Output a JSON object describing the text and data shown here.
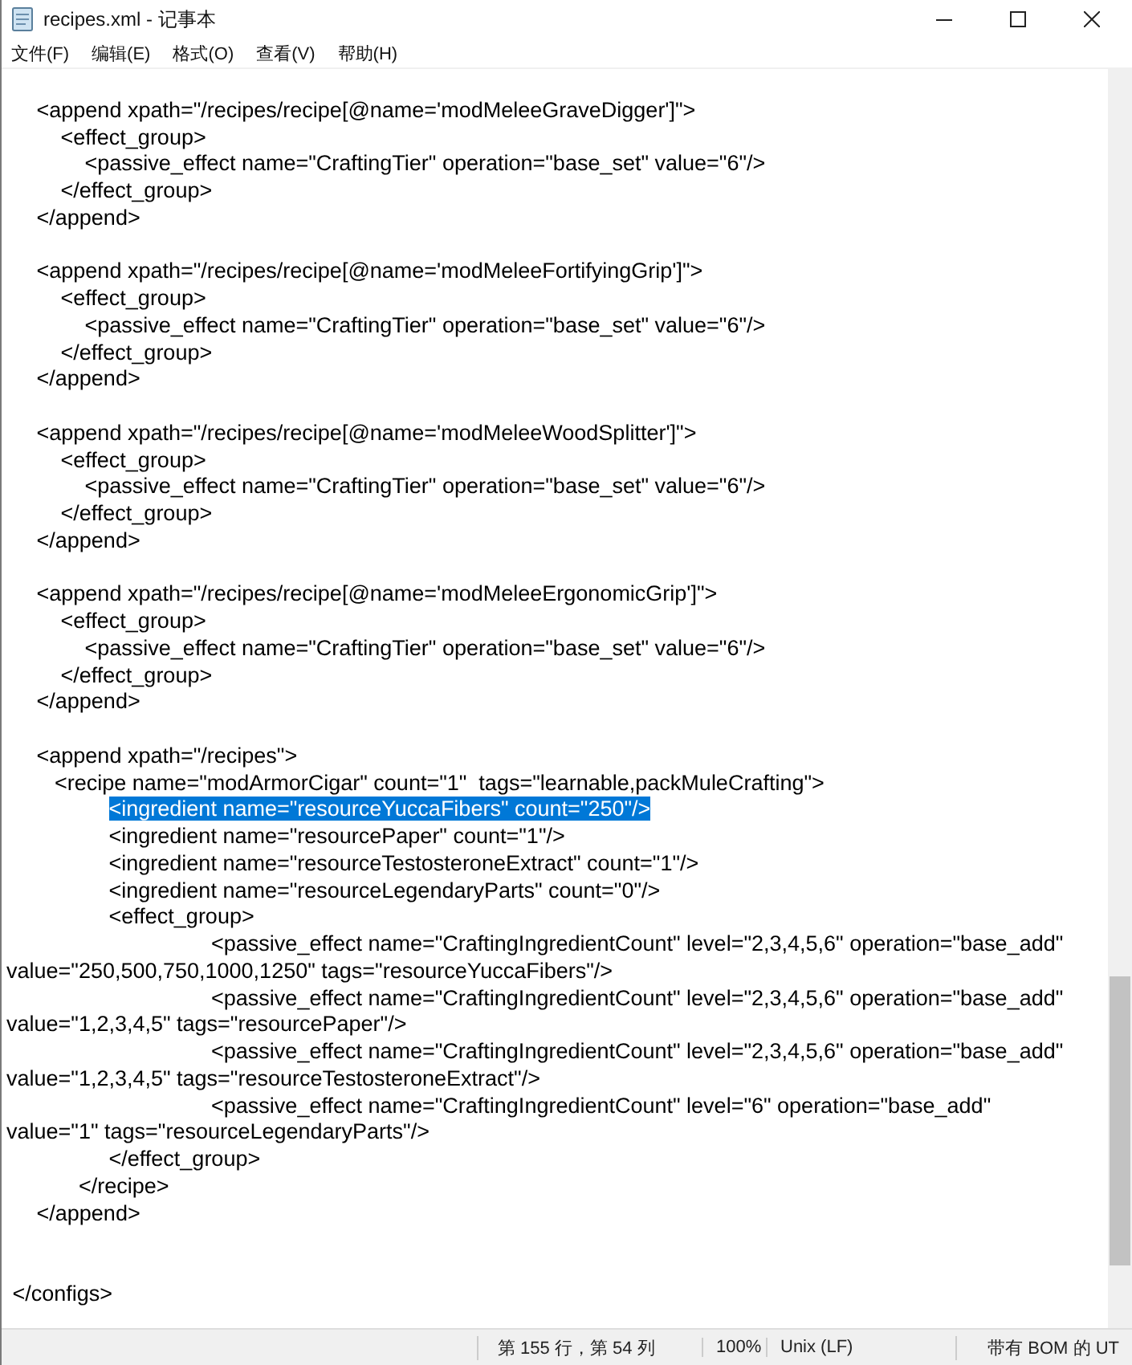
{
  "window": {
    "title": "recipes.xml - 记事本"
  },
  "menu": [
    "文件(F)",
    "编辑(E)",
    "格式(O)",
    "查看(V)",
    "帮助(H)"
  ],
  "lines": [
    {
      "kind": "blank",
      "selected": false
    },
    {
      "kind": "code",
      "text": "     <append xpath=\"/recipes/recipe[@name='modMeleeGraveDigger']\">",
      "selected": false
    },
    {
      "kind": "code",
      "text": "         <effect_group>",
      "selected": false
    },
    {
      "kind": "code",
      "text": "             <passive_effect name=\"CraftingTier\" operation=\"base_set\" value=\"6\"/>",
      "selected": false
    },
    {
      "kind": "code",
      "text": "         </effect_group>",
      "selected": false
    },
    {
      "kind": "code",
      "text": "     </append>",
      "selected": false
    },
    {
      "kind": "blank",
      "selected": false
    },
    {
      "kind": "code",
      "text": "     <append xpath=\"/recipes/recipe[@name='modMeleeFortifyingGrip']\">",
      "selected": false
    },
    {
      "kind": "code",
      "text": "         <effect_group>",
      "selected": false
    },
    {
      "kind": "code",
      "text": "             <passive_effect name=\"CraftingTier\" operation=\"base_set\" value=\"6\"/>",
      "selected": false
    },
    {
      "kind": "code",
      "text": "         </effect_group>",
      "selected": false
    },
    {
      "kind": "code",
      "text": "     </append>",
      "selected": false
    },
    {
      "kind": "blank",
      "selected": false
    },
    {
      "kind": "code",
      "text": "     <append xpath=\"/recipes/recipe[@name='modMeleeWoodSplitter']\">",
      "selected": false
    },
    {
      "kind": "code",
      "text": "         <effect_group>",
      "selected": false
    },
    {
      "kind": "code",
      "text": "             <passive_effect name=\"CraftingTier\" operation=\"base_set\" value=\"6\"/>",
      "selected": false
    },
    {
      "kind": "code",
      "text": "         </effect_group>",
      "selected": false
    },
    {
      "kind": "code",
      "text": "     </append>",
      "selected": false
    },
    {
      "kind": "blank",
      "selected": false
    },
    {
      "kind": "code",
      "text": "     <append xpath=\"/recipes/recipe[@name='modMeleeErgonomicGrip']\">",
      "selected": false
    },
    {
      "kind": "code",
      "text": "         <effect_group>",
      "selected": false
    },
    {
      "kind": "code",
      "text": "             <passive_effect name=\"CraftingTier\" operation=\"base_set\" value=\"6\"/>",
      "selected": false
    },
    {
      "kind": "code",
      "text": "         </effect_group>",
      "selected": false
    },
    {
      "kind": "code",
      "text": "     </append>",
      "selected": false
    },
    {
      "kind": "blank",
      "selected": false
    },
    {
      "kind": "code",
      "text": "     <append xpath=\"/recipes\">",
      "selected": false
    },
    {
      "kind": "code",
      "text": "        <recipe name=\"modArmorCigar\" count=\"1\"  tags=\"learnable,packMuleCrafting\">",
      "selected": false
    },
    {
      "kind": "code",
      "text": "                 <ingredient name=\"resourceYuccaFibers\" count=\"250\"/>",
      "selected": true
    },
    {
      "kind": "code",
      "text": "                 <ingredient name=\"resourcePaper\" count=\"1\"/>",
      "selected": false
    },
    {
      "kind": "code",
      "text": "                 <ingredient name=\"resourceTestosteroneExtract\" count=\"1\"/>",
      "selected": false
    },
    {
      "kind": "code",
      "text": "                 <ingredient name=\"resourceLegendaryParts\" count=\"0\"/>",
      "selected": false
    },
    {
      "kind": "code",
      "text": "                 <effect_group>",
      "selected": false
    },
    {
      "kind": "code",
      "text": "                                  <passive_effect name=\"CraftingIngredientCount\" level=\"2,3,4,5,6\" operation=\"base_add\"",
      "selected": false
    },
    {
      "kind": "code",
      "text": "value=\"250,500,750,1000,1250\" tags=\"resourceYuccaFibers\"/>",
      "selected": false
    },
    {
      "kind": "code",
      "text": "                                  <passive_effect name=\"CraftingIngredientCount\" level=\"2,3,4,5,6\" operation=\"base_add\"",
      "selected": false
    },
    {
      "kind": "code",
      "text": "value=\"1,2,3,4,5\" tags=\"resourcePaper\"/>",
      "selected": false
    },
    {
      "kind": "code",
      "text": "                                  <passive_effect name=\"CraftingIngredientCount\" level=\"2,3,4,5,6\" operation=\"base_add\"",
      "selected": false
    },
    {
      "kind": "code",
      "text": "value=\"1,2,3,4,5\" tags=\"resourceTestosteroneExtract\"/>",
      "selected": false
    },
    {
      "kind": "code",
      "text": "                                  <passive_effect name=\"CraftingIngredientCount\" level=\"6\" operation=\"base_add\"",
      "selected": false
    },
    {
      "kind": "code",
      "text": "value=\"1\" tags=\"resourceLegendaryParts\"/>",
      "selected": false
    },
    {
      "kind": "code",
      "text": "                 </effect_group>",
      "selected": false
    },
    {
      "kind": "code",
      "text": "            </recipe>",
      "selected": false
    },
    {
      "kind": "code",
      "text": "     </append>",
      "selected": false
    },
    {
      "kind": "blank",
      "selected": false
    },
    {
      "kind": "blank",
      "selected": false
    },
    {
      "kind": "code",
      "text": " </configs>",
      "selected": false
    }
  ],
  "status_bar": [
    "第 155 行，第 54 列",
    "100%",
    "Unix (LF)",
    "带有 BOM 的 UT"
  ]
}
